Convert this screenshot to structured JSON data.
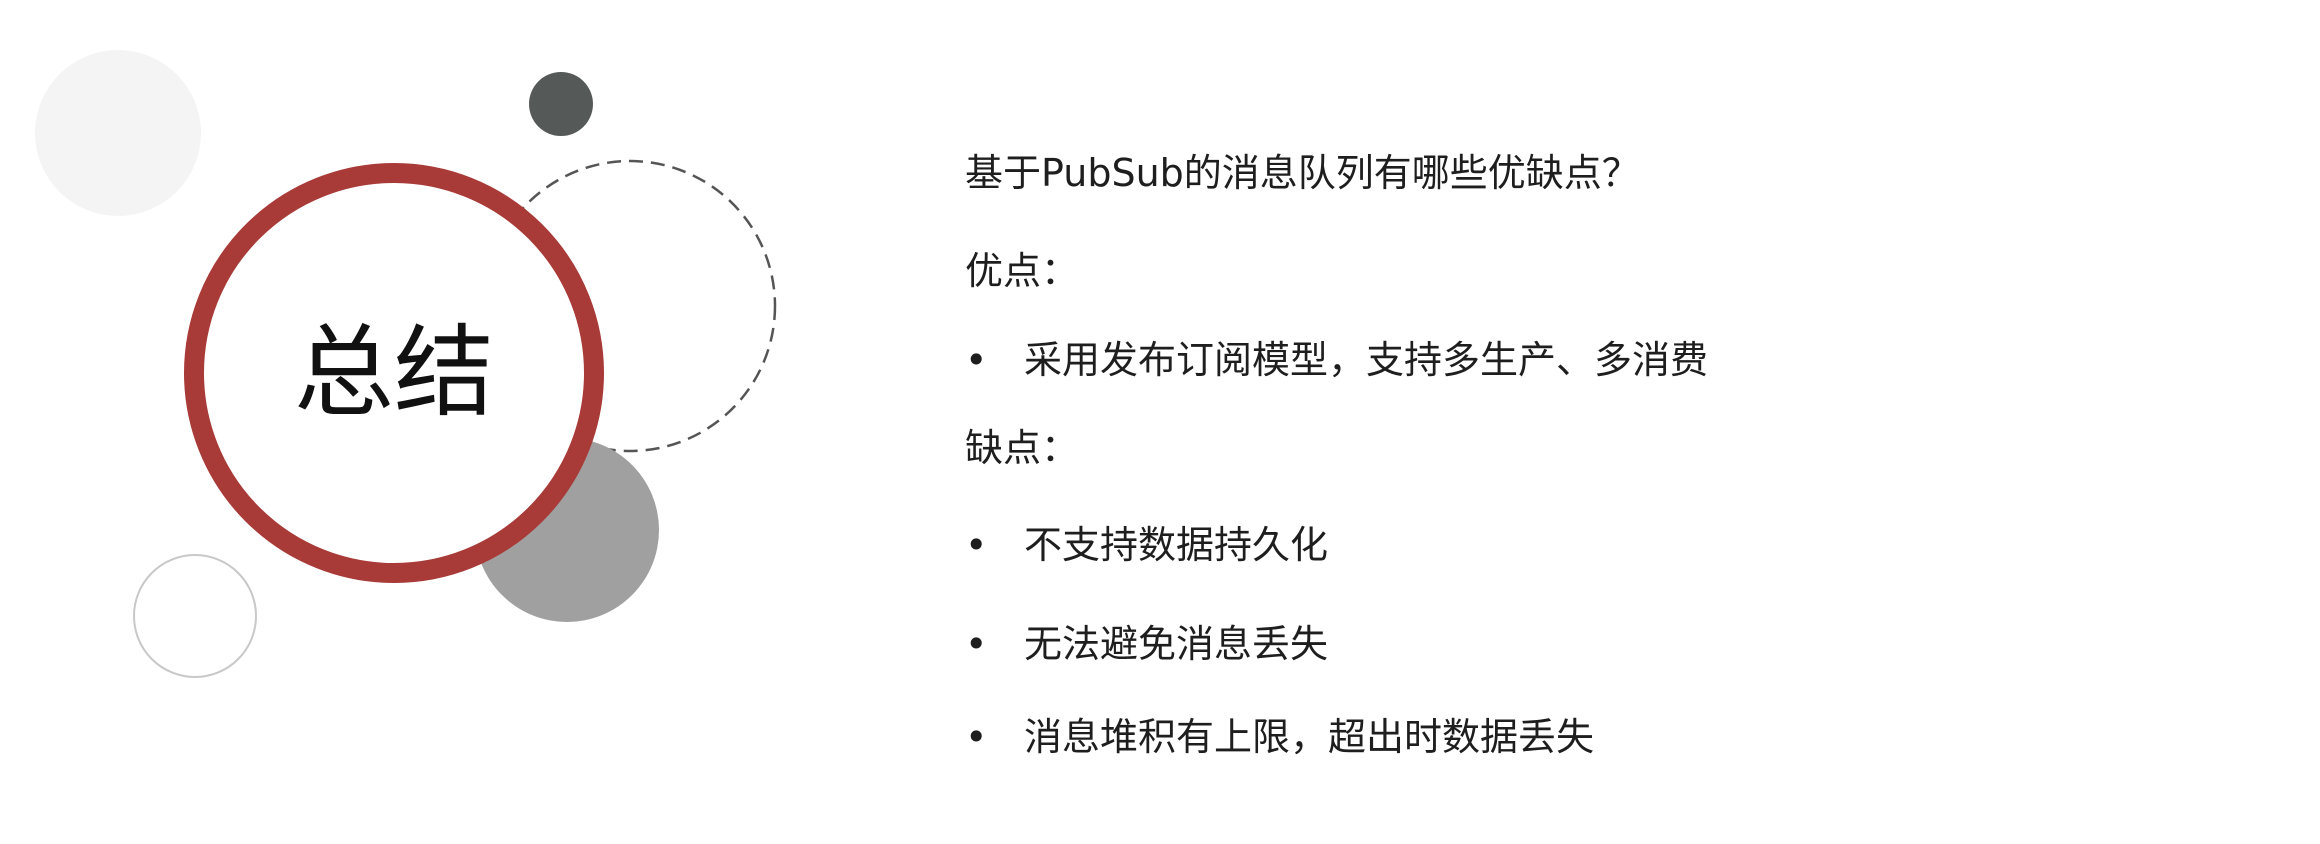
{
  "slide": {
    "badge_title": "总结",
    "question": "基于PubSub的消息队列有哪些优缺点？",
    "pros_heading": "优点：",
    "pros": [
      "采用发布订阅模型，支持多生产、多消费"
    ],
    "cons_heading": "缺点：",
    "cons": [
      "不支持数据持久化",
      "无法避免消息丢失",
      "消息堆积有上限，超出时数据丢失"
    ],
    "bullet": "•"
  },
  "colors": {
    "accent": "#a83a37",
    "dark_dot": "#555a58",
    "gray_dot": "#a0a0a0",
    "light_dot": "#f4f4f4"
  }
}
